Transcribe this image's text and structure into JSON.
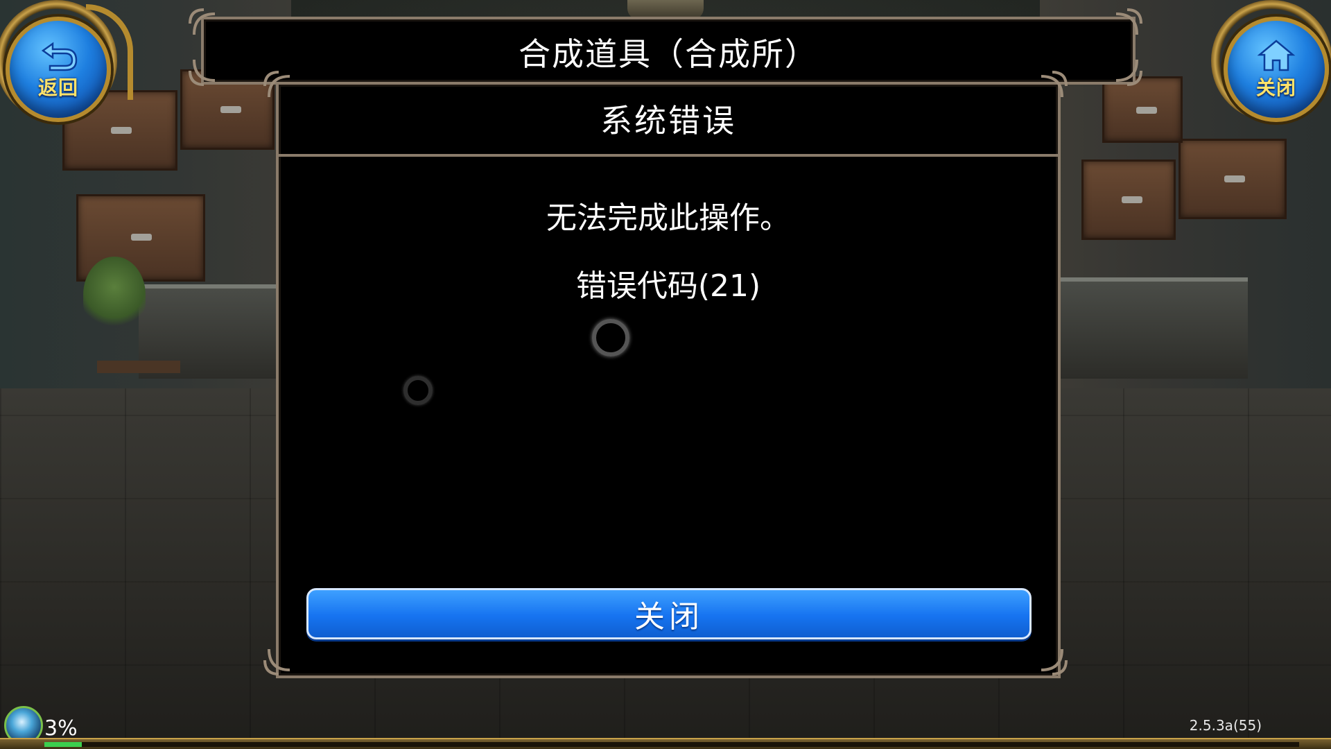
{
  "nav": {
    "back_label": "返回",
    "back_icon": "back-arrow-icon",
    "close_label": "关闭",
    "close_icon": "home-icon"
  },
  "header": {
    "title": "合成道具（合成所）"
  },
  "dialog": {
    "title": "系统错误",
    "message": "无法完成此操作。",
    "error_code": "错误代码(21)",
    "close_button_label": "关闭"
  },
  "status": {
    "progress_text": "3%",
    "progress_value": 0.03,
    "version": "2.5.3a(55)"
  },
  "colors": {
    "button_blue": "#1673f0",
    "frame": "#8a7b6a",
    "nav_caption": "#ffe36a",
    "progress": "#3ccf4e"
  }
}
